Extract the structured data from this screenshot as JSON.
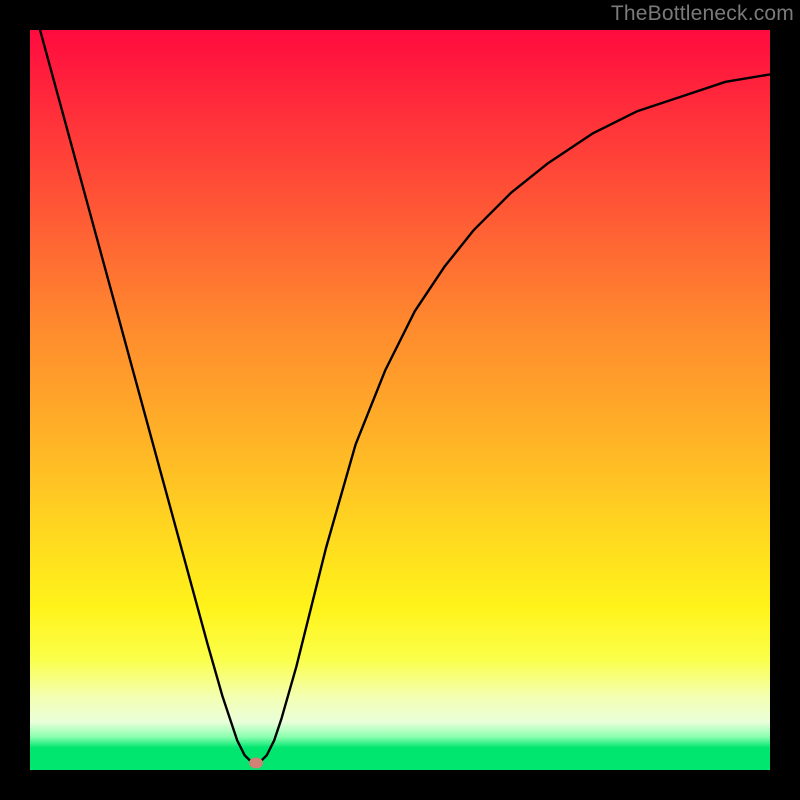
{
  "watermark": "TheBottleneck.com",
  "chart_data": {
    "type": "line",
    "title": "",
    "xlabel": "",
    "ylabel": "",
    "xlim": [
      0,
      100
    ],
    "ylim": [
      0,
      100
    ],
    "series": [
      {
        "name": "bottleneck-curve",
        "x": [
          0,
          3,
          6,
          9,
          12,
          15,
          18,
          21,
          24,
          26,
          27,
          28,
          29,
          30,
          31,
          32,
          33,
          34,
          36,
          38,
          40,
          44,
          48,
          52,
          56,
          60,
          65,
          70,
          76,
          82,
          88,
          94,
          100
        ],
        "y": [
          105,
          94,
          83,
          72,
          61,
          50,
          39,
          28,
          17,
          10,
          7,
          4,
          2,
          1,
          1,
          2,
          4,
          7,
          14,
          22,
          30,
          44,
          54,
          62,
          68,
          73,
          78,
          82,
          86,
          89,
          91,
          93,
          94
        ]
      }
    ],
    "marker": {
      "x": 30.5,
      "y": 1
    },
    "colors": {
      "curve": "#000000",
      "marker": "#cf8376"
    }
  }
}
